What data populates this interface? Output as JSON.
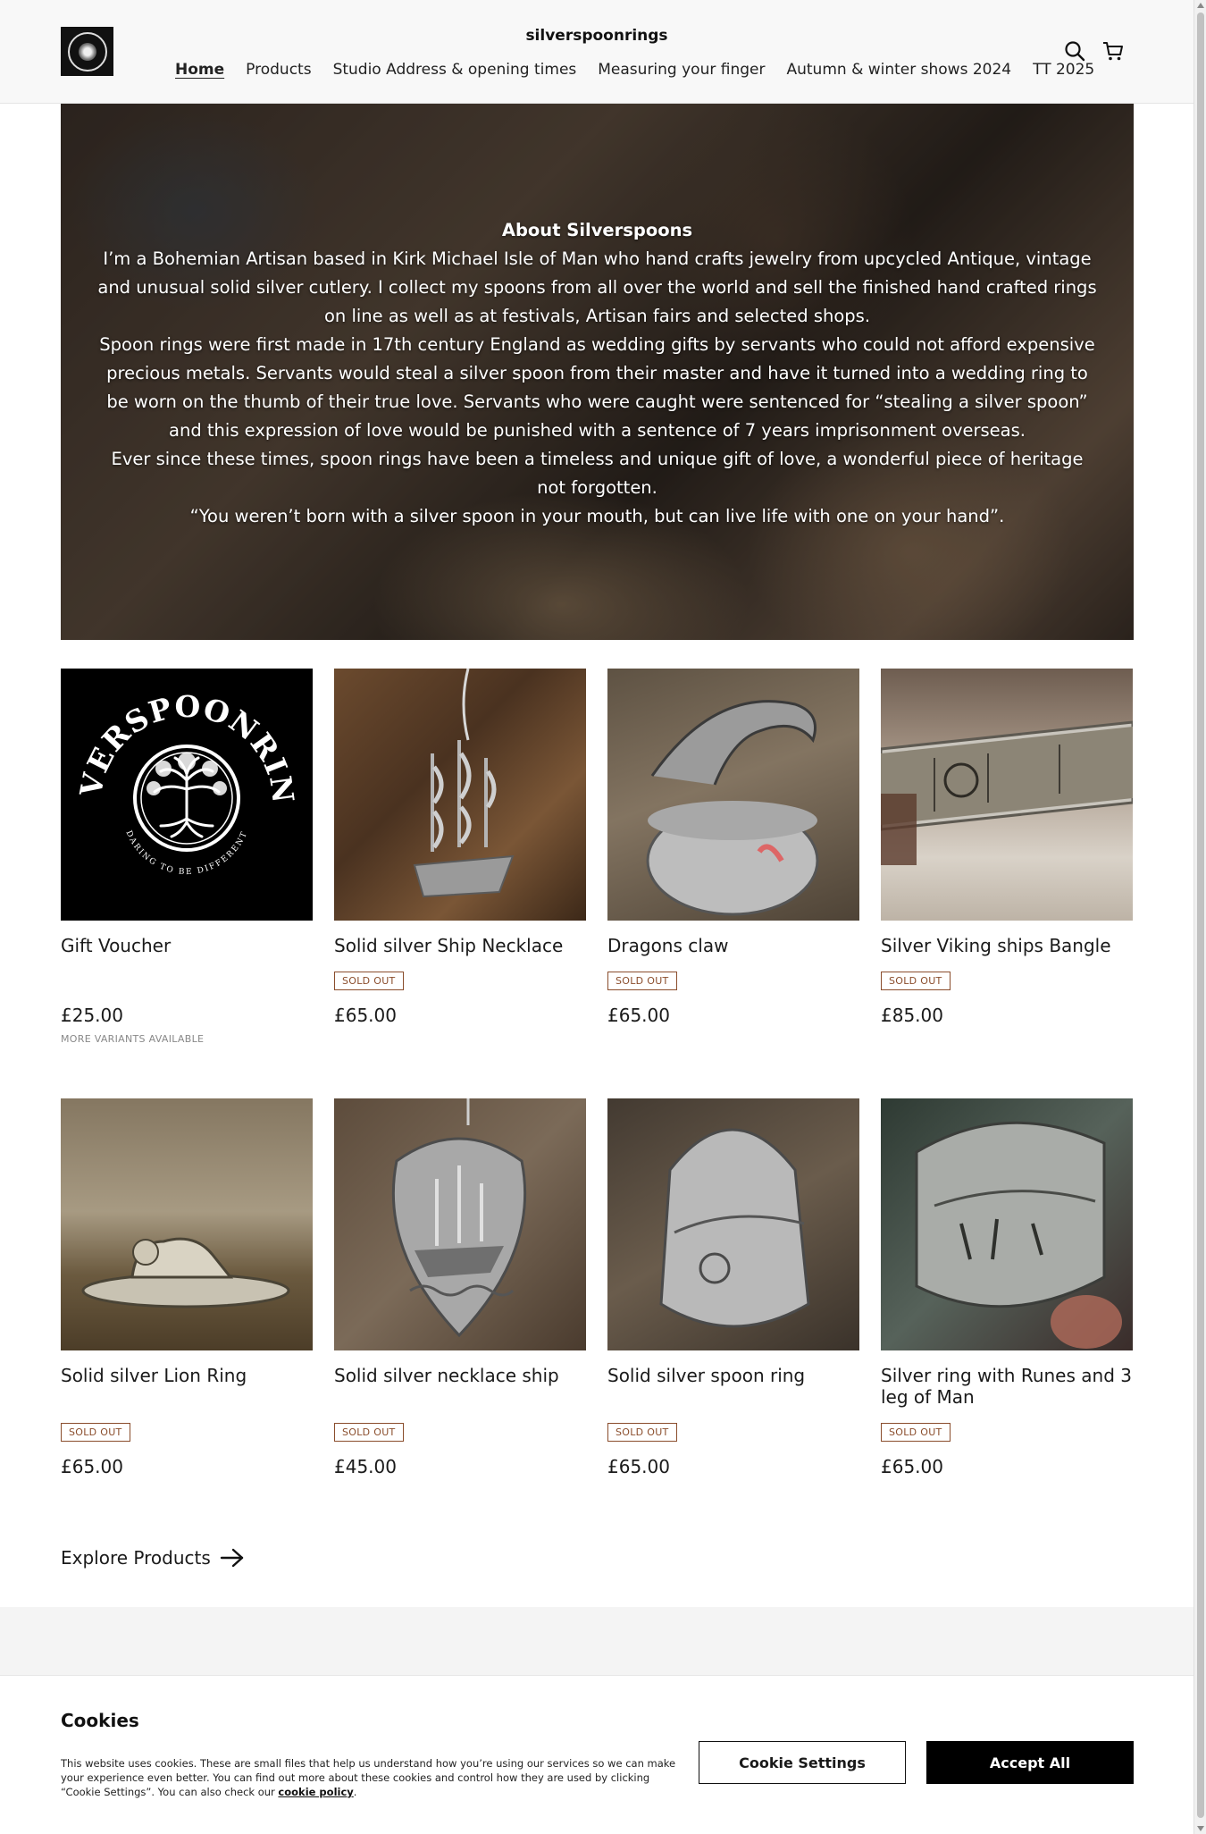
{
  "header": {
    "site_name": "silverspoonrings",
    "nav": [
      "Home",
      "Products",
      "Studio Address & opening times",
      "Measuring your finger",
      "Autumn & winter shows 2024",
      "TT 2025"
    ],
    "icons": [
      "search-icon",
      "cart-icon"
    ]
  },
  "hero": {
    "title": "About Silverspoons",
    "paragraphs": [
      "I’m a Bohemian Artisan based in Kirk Michael Isle of Man who hand crafts jewelry from upcycled Antique, vintage and unusual solid silver cutlery. I collect my spoons from all over the world and sell the finished hand crafted rings on line as well as at festivals, Artisan fairs and selected shops.",
      "Spoon rings were first made in 17th century England as wedding gifts by servants who could not afford expensive precious metals. Servants would steal a silver spoon from their master and have it turned into a wedding ring to be worn on the thumb of their true love. Servants who were caught were sentenced for “stealing a silver spoon” and this expression of love would be punished with a sentence of 7 years imprisonment overseas.",
      "Ever since these times, spoon rings have been a timeless and unique gift of love, a wonderful piece of heritage not forgotten.",
      "“You weren’t born with a silver spoon in your mouth, but can live life with one on your hand”."
    ]
  },
  "products": [
    {
      "name": "Gift Voucher",
      "badge": "",
      "price": "£25.00",
      "note": "MORE VARIANTS AVAILABLE",
      "logo_text_top": "SILVERSPOONRINGS",
      "logo_text_bottom": "DARING TO BE DIFFERENT"
    },
    {
      "name": "Solid silver Ship Necklace",
      "badge": "SOLD OUT",
      "price": "£65.00",
      "note": ""
    },
    {
      "name": "Dragons claw",
      "badge": "SOLD OUT",
      "price": "£65.00",
      "note": ""
    },
    {
      "name": "Silver Viking ships Bangle",
      "badge": "SOLD OUT",
      "price": "£85.00",
      "note": ""
    },
    {
      "name": "Solid silver Lion Ring",
      "badge": "SOLD OUT",
      "price": "£65.00",
      "note": ""
    },
    {
      "name": "Solid silver necklace ship",
      "badge": "SOLD OUT",
      "price": "£45.00",
      "note": ""
    },
    {
      "name": "Solid silver spoon ring",
      "badge": "SOLD OUT",
      "price": "£65.00",
      "note": ""
    },
    {
      "name": "Silver ring with Runes and 3 leg of Man",
      "badge": "SOLD OUT",
      "price": "£65.00",
      "note": ""
    }
  ],
  "explore": {
    "label": "Explore Products"
  },
  "cookie": {
    "title": "Cookies",
    "text": "This website uses cookies. These are small files that help us understand how you’re using our services so we can make your experience even better. You can find out more about these cookies and control how they are used by clicking “Cookie Settings”. You can also check our ",
    "link": "cookie policy",
    "after_link": ".",
    "settings_label": "Cookie Settings",
    "accept_label": "Accept All"
  }
}
